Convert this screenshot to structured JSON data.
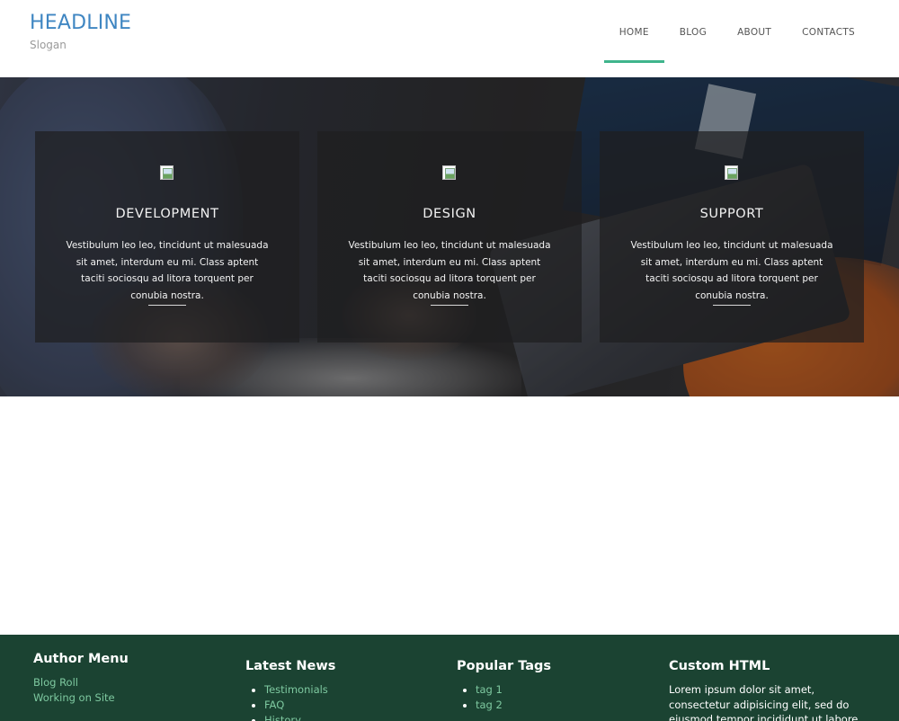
{
  "header": {
    "brand_title": "HEADLINE",
    "brand_slogan": "Slogan",
    "nav": [
      {
        "label": "HOME",
        "active": true
      },
      {
        "label": "BLOG",
        "active": false
      },
      {
        "label": "ABOUT",
        "active": false
      },
      {
        "label": "CONTACTS",
        "active": false
      }
    ],
    "accent_color": "#3fb48c",
    "brand_color": "#3f86c2"
  },
  "hero": {
    "features": [
      {
        "title": "DEVELOPMENT",
        "text": "Vestibulum leo leo, tincidunt ut malesuada sit amet, interdum eu mi. Class aptent taciti sociosqu ad litora torquent per conubia nostra.",
        "icon": "broken-image-icon"
      },
      {
        "title": "DESIGN",
        "text": "Vestibulum leo leo, tincidunt ut malesuada sit amet, interdum eu mi. Class aptent taciti sociosqu ad litora torquent per conubia nostra.",
        "icon": "broken-image-icon"
      },
      {
        "title": "SUPPORT",
        "text": "Vestibulum leo leo, tincidunt ut malesuada sit amet, interdum eu mi. Class aptent taciti sociosqu ad litora torquent per conubia nostra.",
        "icon": "broken-image-icon"
      }
    ]
  },
  "footer": {
    "background": "#1b4332",
    "author_menu": {
      "title": "Author Menu",
      "links": [
        "Blog Roll",
        "Working on Site"
      ]
    },
    "latest_news": {
      "title": "Latest News",
      "items": [
        "Testimonials",
        "FAQ",
        "History"
      ]
    },
    "popular_tags": {
      "title": "Popular Tags",
      "items": [
        "tag 1",
        "tag 2"
      ]
    },
    "custom_html": {
      "title": "Custom HTML",
      "text": "Lorem ipsum dolor sit amet, consectetur adipisicing elit, sed do eiusmod tempor incididunt ut labore et dolore magna"
    }
  }
}
